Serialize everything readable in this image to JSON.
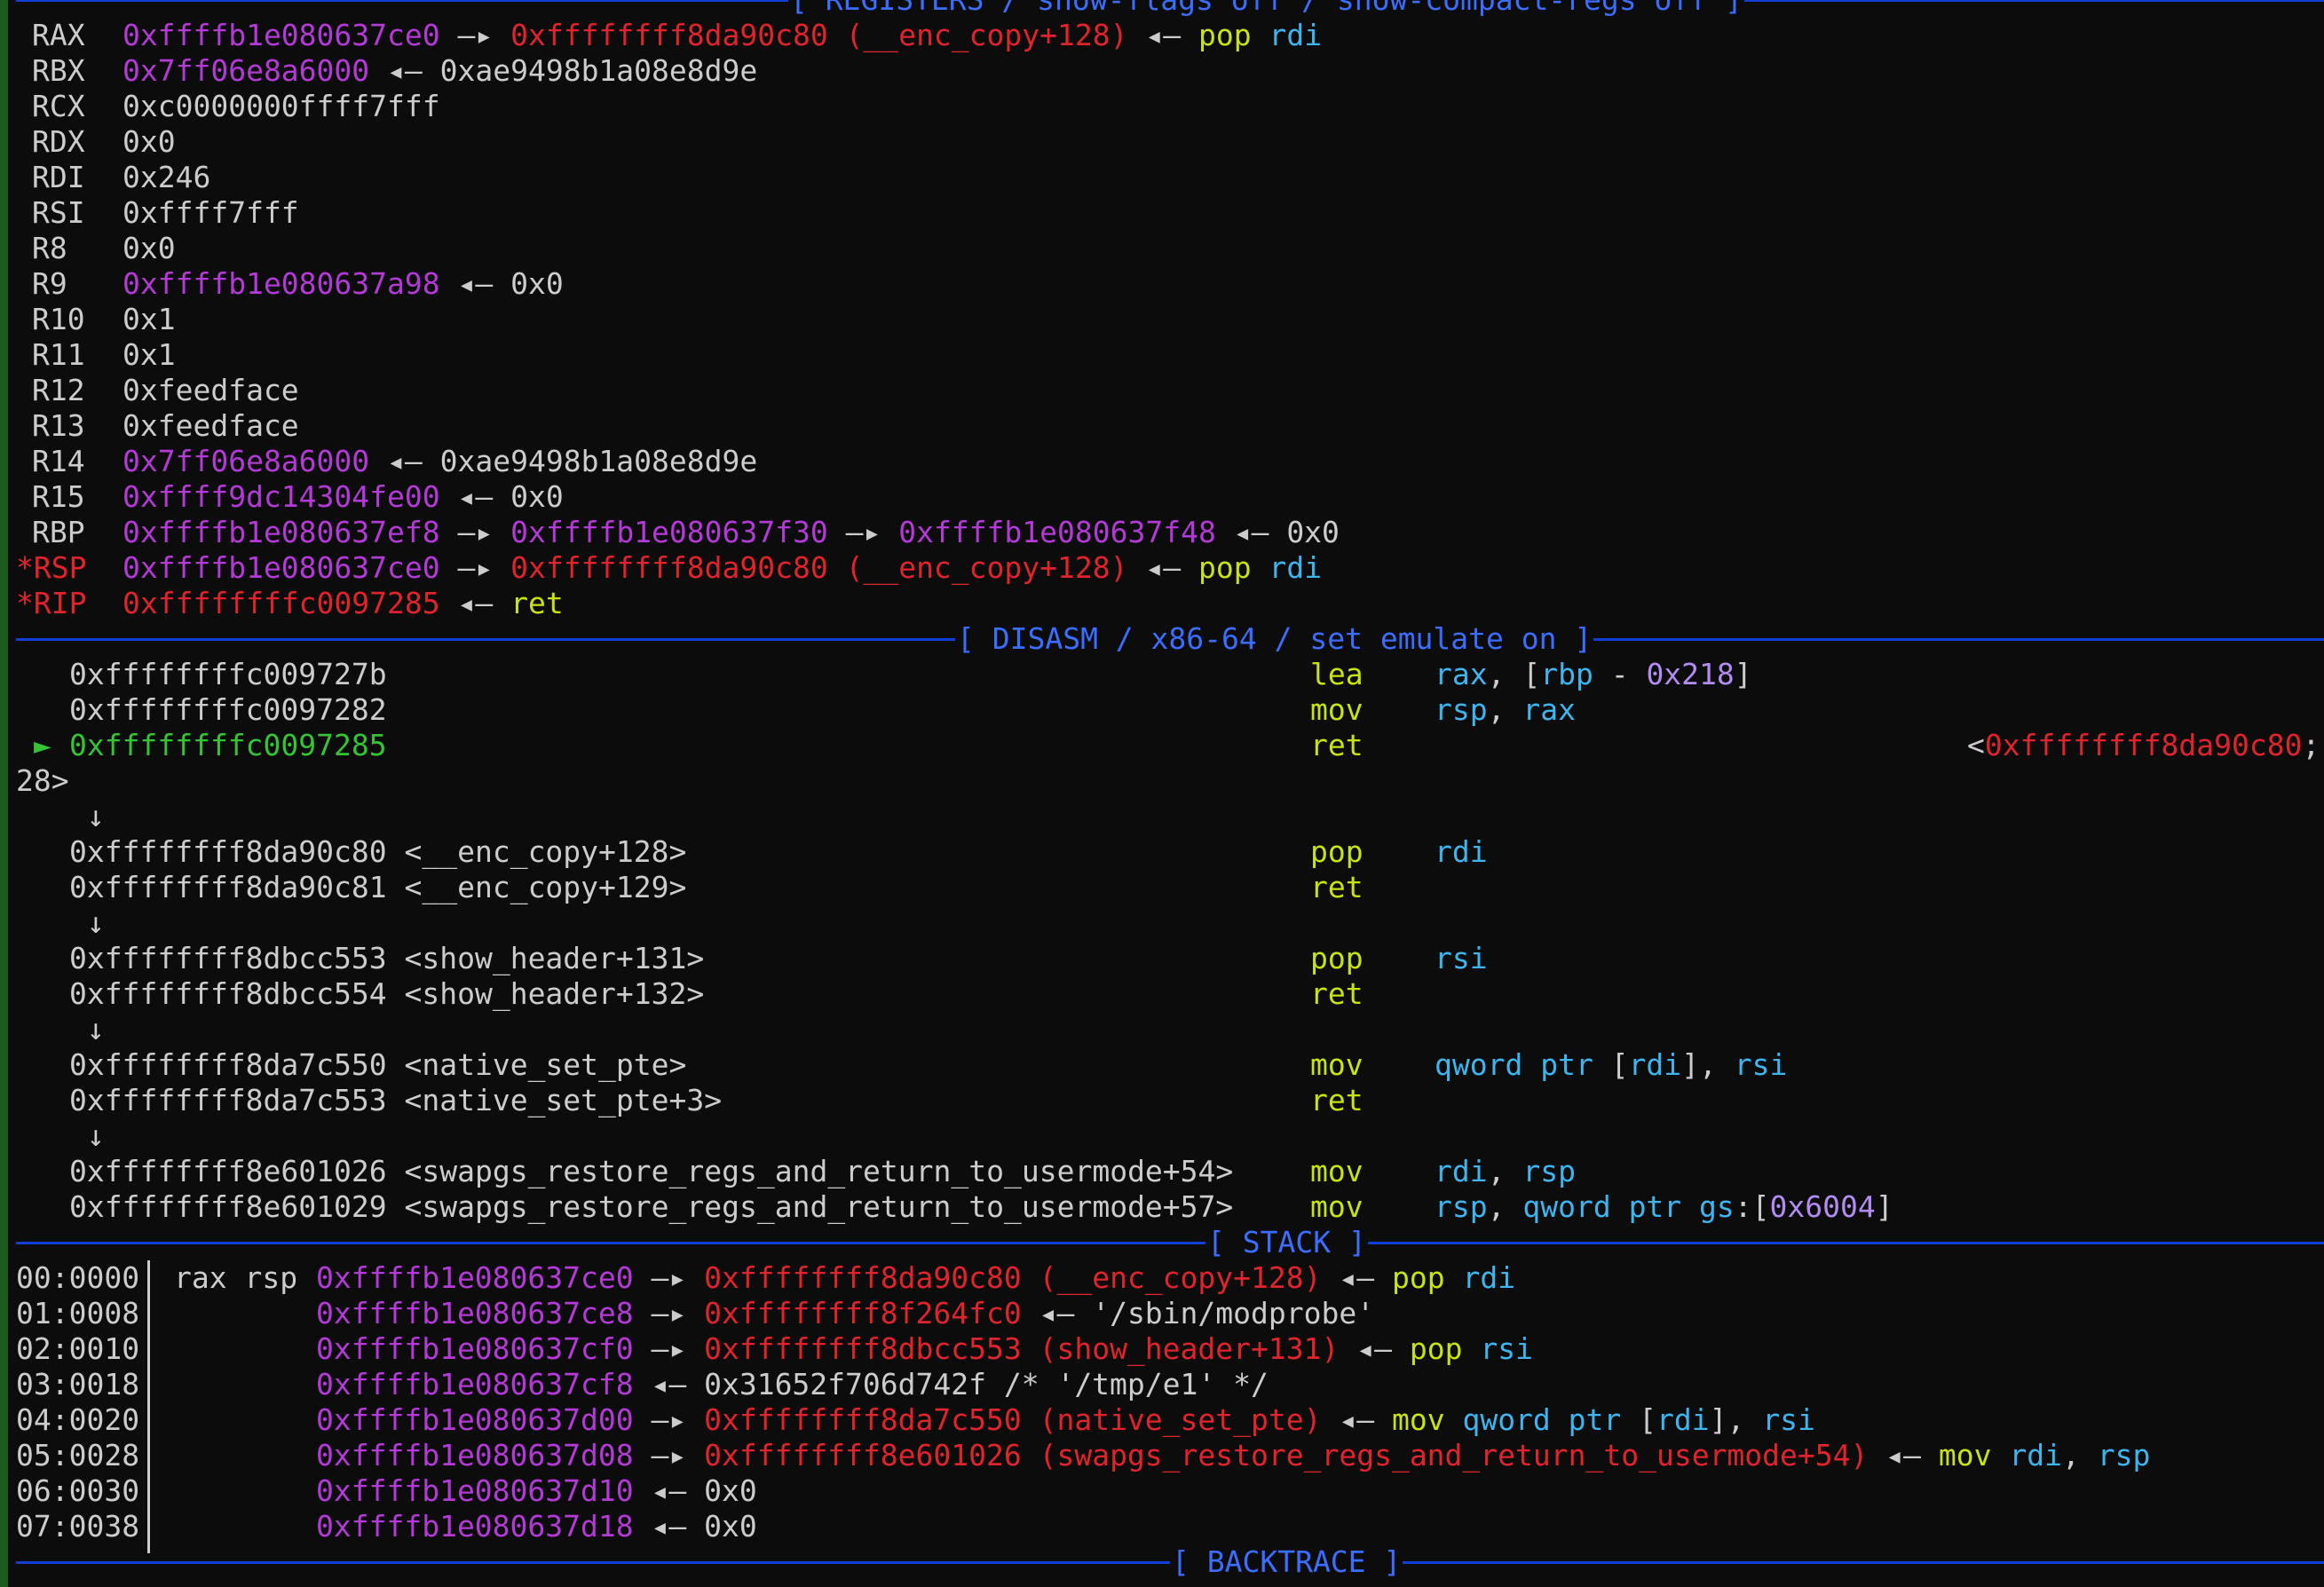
{
  "headers": {
    "registers": "[ REGISTERS / show-flags off / show-compact-regs off ]",
    "disasm": "[ DISASM / x86-64 / set emulate on ]",
    "stack": "[ STACK ]",
    "backtrace": "[ BACKTRACE ]"
  },
  "registers": [
    {
      "name": "RAX",
      "parts": [
        {
          "t": "0xffffb1e080637ce0",
          "c": "mag"
        },
        {
          "t": " —▸ ",
          "c": "wht"
        },
        {
          "t": "0xffffffff8da90c80 (__enc_copy+128)",
          "c": "red"
        },
        {
          "t": " ◂— ",
          "c": "wht"
        },
        {
          "t": "pop",
          "c": "yel"
        },
        {
          "t": " ",
          "c": "wht"
        },
        {
          "t": "rdi",
          "c": "cyan"
        }
      ]
    },
    {
      "name": "RBX",
      "parts": [
        {
          "t": "0x7ff06e8a6000",
          "c": "mag"
        },
        {
          "t": " ◂— 0xae9498b1a08e8d9e",
          "c": "wht"
        }
      ]
    },
    {
      "name": "RCX",
      "parts": [
        {
          "t": "0xc0000000ffff7fff",
          "c": "wht"
        }
      ]
    },
    {
      "name": "RDX",
      "parts": [
        {
          "t": "0x0",
          "c": "wht"
        }
      ]
    },
    {
      "name": "RDI",
      "parts": [
        {
          "t": "0x246",
          "c": "wht"
        }
      ]
    },
    {
      "name": "RSI",
      "parts": [
        {
          "t": "0xffff7fff",
          "c": "wht"
        }
      ]
    },
    {
      "name": "R8",
      "parts": [
        {
          "t": "0x0",
          "c": "wht"
        }
      ]
    },
    {
      "name": "R9",
      "parts": [
        {
          "t": "0xffffb1e080637a98",
          "c": "mag"
        },
        {
          "t": " ◂— 0x0",
          "c": "wht"
        }
      ]
    },
    {
      "name": "R10",
      "parts": [
        {
          "t": "0x1",
          "c": "wht"
        }
      ]
    },
    {
      "name": "R11",
      "parts": [
        {
          "t": "0x1",
          "c": "wht"
        }
      ]
    },
    {
      "name": "R12",
      "parts": [
        {
          "t": "0xfeedface",
          "c": "wht"
        }
      ]
    },
    {
      "name": "R13",
      "parts": [
        {
          "t": "0xfeedface",
          "c": "wht"
        }
      ]
    },
    {
      "name": "R14",
      "parts": [
        {
          "t": "0x7ff06e8a6000",
          "c": "mag"
        },
        {
          "t": " ◂— 0xae9498b1a08e8d9e",
          "c": "wht"
        }
      ]
    },
    {
      "name": "R15",
      "parts": [
        {
          "t": "0xffff9dc14304fe00",
          "c": "mag"
        },
        {
          "t": " ◂— 0x0",
          "c": "wht"
        }
      ]
    },
    {
      "name": "RBP",
      "parts": [
        {
          "t": "0xffffb1e080637ef8",
          "c": "mag"
        },
        {
          "t": " —▸ ",
          "c": "wht"
        },
        {
          "t": "0xffffb1e080637f30",
          "c": "mag"
        },
        {
          "t": " —▸ ",
          "c": "wht"
        },
        {
          "t": "0xffffb1e080637f48",
          "c": "mag"
        },
        {
          "t": " ◂— 0x0",
          "c": "wht"
        }
      ]
    },
    {
      "name": "*RSP",
      "changed": true,
      "parts": [
        {
          "t": "0xffffb1e080637ce0",
          "c": "mag"
        },
        {
          "t": " —▸ ",
          "c": "wht"
        },
        {
          "t": "0xffffffff8da90c80 (__enc_copy+128)",
          "c": "red"
        },
        {
          "t": " ◂— ",
          "c": "wht"
        },
        {
          "t": "pop",
          "c": "yel"
        },
        {
          "t": " ",
          "c": "wht"
        },
        {
          "t": "rdi",
          "c": "cyan"
        }
      ]
    },
    {
      "name": "*RIP",
      "changed": true,
      "parts": [
        {
          "t": "0xffffffffc0097285",
          "c": "red"
        },
        {
          "t": " ◂— ",
          "c": "wht"
        },
        {
          "t": "ret",
          "c": "yel"
        }
      ]
    }
  ],
  "disasm": [
    {
      "addr": "0xffffffffc009727b",
      "sym": "",
      "mn": "lea",
      "ops": [
        {
          "t": "rax",
          "c": "cyan"
        },
        {
          "t": ", [",
          "c": "wht"
        },
        {
          "t": "rbp",
          "c": "cyan"
        },
        {
          "t": " - ",
          "c": "wht"
        },
        {
          "t": "0x218",
          "c": "lav"
        },
        {
          "t": "]",
          "c": "wht"
        }
      ]
    },
    {
      "addr": "0xffffffffc0097282",
      "sym": "",
      "mn": "mov",
      "ops": [
        {
          "t": "rsp",
          "c": "cyan"
        },
        {
          "t": ", ",
          "c": "wht"
        },
        {
          "t": "rax",
          "c": "cyan"
        }
      ]
    },
    {
      "addr": "0xffffffffc0097285",
      "sym": "",
      "mn": "ret",
      "current": true,
      "marker": "►",
      "ops": [],
      "trail": "<0xffffffff8da90c80;"
    },
    {
      "wrap": "28>"
    },
    {
      "arrow": "↓"
    },
    {
      "addr": "0xffffffff8da90c80",
      "sym": " <__enc_copy+128>",
      "mn": "pop",
      "ops": [
        {
          "t": "rdi",
          "c": "cyan"
        }
      ]
    },
    {
      "addr": "0xffffffff8da90c81",
      "sym": " <__enc_copy+129>",
      "mn": "ret",
      "ops": []
    },
    {
      "arrow": "↓"
    },
    {
      "addr": "0xffffffff8dbcc553",
      "sym": " <show_header+131>",
      "mn": "pop",
      "ops": [
        {
          "t": "rsi",
          "c": "cyan"
        }
      ]
    },
    {
      "addr": "0xffffffff8dbcc554",
      "sym": " <show_header+132>",
      "mn": "ret",
      "ops": []
    },
    {
      "arrow": "↓"
    },
    {
      "addr": "0xffffffff8da7c550",
      "sym": " <native_set_pte>",
      "mn": "mov",
      "ops": [
        {
          "t": "qword ptr",
          "c": "cyan"
        },
        {
          "t": " [",
          "c": "wht"
        },
        {
          "t": "rdi",
          "c": "cyan"
        },
        {
          "t": "], ",
          "c": "wht"
        },
        {
          "t": "rsi",
          "c": "cyan"
        }
      ]
    },
    {
      "addr": "0xffffffff8da7c553",
      "sym": " <native_set_pte+3>",
      "mn": "ret",
      "ops": []
    },
    {
      "arrow": "↓"
    },
    {
      "addr": "0xffffffff8e601026",
      "sym": " <swapgs_restore_regs_and_return_to_usermode+54>",
      "mn": "mov",
      "ops": [
        {
          "t": "rdi",
          "c": "cyan"
        },
        {
          "t": ", ",
          "c": "wht"
        },
        {
          "t": "rsp",
          "c": "cyan"
        }
      ]
    },
    {
      "addr": "0xffffffff8e601029",
      "sym": " <swapgs_restore_regs_and_return_to_usermode+57>",
      "mn": "mov",
      "ops": [
        {
          "t": "rsp",
          "c": "cyan"
        },
        {
          "t": ", ",
          "c": "wht"
        },
        {
          "t": "qword ptr",
          "c": "cyan"
        },
        {
          "t": " ",
          "c": "wht"
        },
        {
          "t": "gs",
          "c": "cyan"
        },
        {
          "t": ":[",
          "c": "wht"
        },
        {
          "t": "0x6004",
          "c": "lav"
        },
        {
          "t": "]",
          "c": "wht"
        }
      ]
    }
  ],
  "stack": [
    {
      "idx": "00:0000",
      "regs": "rax rsp",
      "parts": [
        {
          "t": "0xffffb1e080637ce0",
          "c": "mag"
        },
        {
          "t": " —▸ ",
          "c": "wht"
        },
        {
          "t": "0xffffffff8da90c80 (__enc_copy+128)",
          "c": "red"
        },
        {
          "t": " ◂— ",
          "c": "wht"
        },
        {
          "t": "pop",
          "c": "yel"
        },
        {
          "t": " ",
          "c": "wht"
        },
        {
          "t": "rdi",
          "c": "cyan"
        }
      ]
    },
    {
      "idx": "01:0008",
      "regs": "",
      "parts": [
        {
          "t": "0xffffb1e080637ce8",
          "c": "mag"
        },
        {
          "t": " —▸ ",
          "c": "wht"
        },
        {
          "t": "0xffffffff8f264fc0",
          "c": "red"
        },
        {
          "t": " ◂— '/sbin/modprobe'",
          "c": "wht"
        }
      ]
    },
    {
      "idx": "02:0010",
      "regs": "",
      "parts": [
        {
          "t": "0xffffb1e080637cf0",
          "c": "mag"
        },
        {
          "t": " —▸ ",
          "c": "wht"
        },
        {
          "t": "0xffffffff8dbcc553 (show_header+131)",
          "c": "red"
        },
        {
          "t": " ◂— ",
          "c": "wht"
        },
        {
          "t": "pop",
          "c": "yel"
        },
        {
          "t": " ",
          "c": "wht"
        },
        {
          "t": "rsi",
          "c": "cyan"
        }
      ]
    },
    {
      "idx": "03:0018",
      "regs": "",
      "parts": [
        {
          "t": "0xffffb1e080637cf8",
          "c": "mag"
        },
        {
          "t": " ◂— 0x31652f706d742f /* '/tmp/e1' */",
          "c": "wht"
        }
      ]
    },
    {
      "idx": "04:0020",
      "regs": "",
      "parts": [
        {
          "t": "0xffffb1e080637d00",
          "c": "mag"
        },
        {
          "t": " —▸ ",
          "c": "wht"
        },
        {
          "t": "0xffffffff8da7c550 (native_set_pte)",
          "c": "red"
        },
        {
          "t": " ◂— ",
          "c": "wht"
        },
        {
          "t": "mov",
          "c": "yel"
        },
        {
          "t": " ",
          "c": "wht"
        },
        {
          "t": "qword ptr",
          "c": "cyan"
        },
        {
          "t": " [",
          "c": "wht"
        },
        {
          "t": "rdi",
          "c": "cyan"
        },
        {
          "t": "], ",
          "c": "wht"
        },
        {
          "t": "rsi",
          "c": "cyan"
        }
      ]
    },
    {
      "idx": "05:0028",
      "regs": "",
      "parts": [
        {
          "t": "0xffffb1e080637d08",
          "c": "mag"
        },
        {
          "t": " —▸ ",
          "c": "wht"
        },
        {
          "t": "0xffffffff8e601026 (swapgs_restore_regs_and_return_to_usermode+54)",
          "c": "red"
        },
        {
          "t": " ◂— ",
          "c": "wht"
        },
        {
          "t": "mov",
          "c": "yel"
        },
        {
          "t": " ",
          "c": "wht"
        },
        {
          "t": "rdi",
          "c": "cyan"
        },
        {
          "t": ", ",
          "c": "wht"
        },
        {
          "t": "rsp",
          "c": "cyan"
        }
      ]
    },
    {
      "idx": "06:0030",
      "regs": "",
      "parts": [
        {
          "t": "0xffffb1e080637d10",
          "c": "mag"
        },
        {
          "t": " ◂— 0x0",
          "c": "wht"
        }
      ]
    },
    {
      "idx": "07:0038",
      "regs": "",
      "parts": [
        {
          "t": "0xffffb1e080637d18",
          "c": "mag"
        },
        {
          "t": " ◂— 0x0",
          "c": "wht"
        }
      ]
    }
  ],
  "colors": {
    "background": "#0c0c0c",
    "text": "#cccccc",
    "magenta": "#b33ad6",
    "red": "#e0242c",
    "yellow": "#c9e212",
    "cyan": "#3fb5f0",
    "green": "#34c434",
    "lavender": "#b28cf0",
    "header": "#3b6dff"
  }
}
